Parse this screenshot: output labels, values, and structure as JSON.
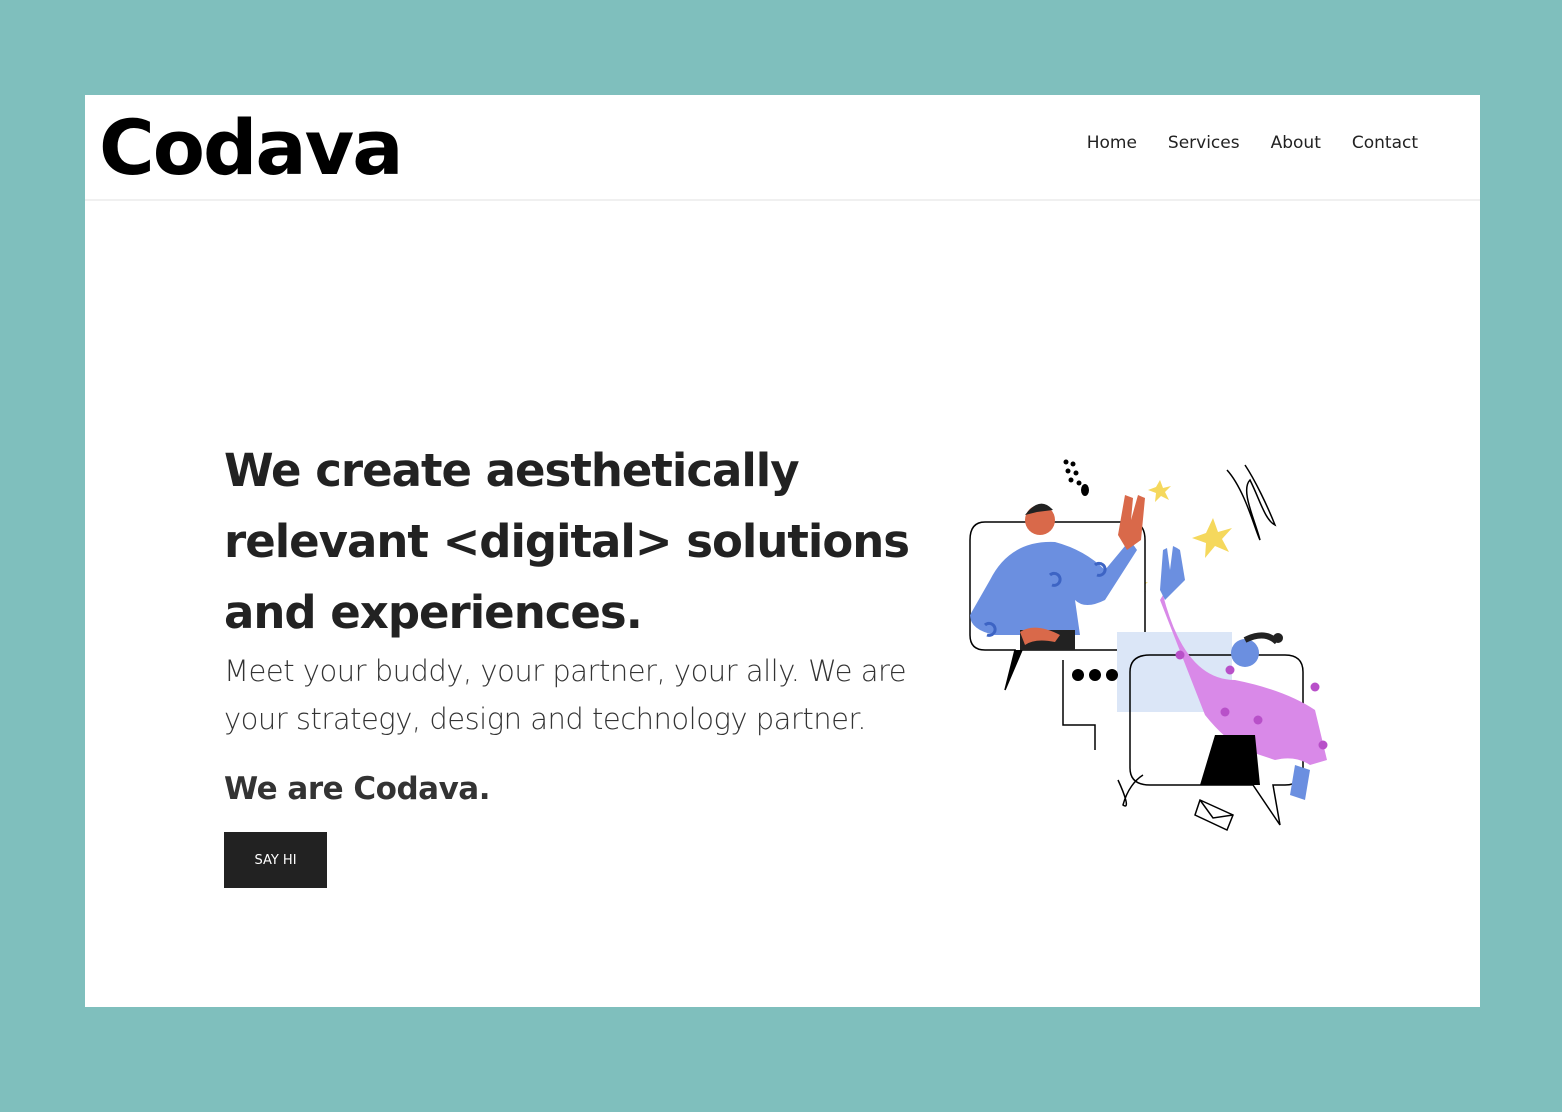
{
  "brand": {
    "logo": "Codava"
  },
  "nav": {
    "items": [
      {
        "label": "Home"
      },
      {
        "label": "Services"
      },
      {
        "label": "About"
      },
      {
        "label": "Contact"
      }
    ]
  },
  "hero": {
    "headline": "We create aesthetically relevant <digital> solutions and experiences.",
    "subtitle": "Meet your buddy, your partner, your ally. We are your strategy, design and technology partner.",
    "tagline": "We are Codava.",
    "cta_label": "SAY HI"
  },
  "colors": {
    "frame": "#7fbfbd",
    "background": "#ffffff",
    "text": "#222222",
    "button": "#222222",
    "person_blue": "#6b8fe0",
    "person_pink": "#d989e8",
    "skin_orange": "#d9694a",
    "star_yellow": "#f5d85c",
    "panel_light": "#dbe6f7"
  }
}
